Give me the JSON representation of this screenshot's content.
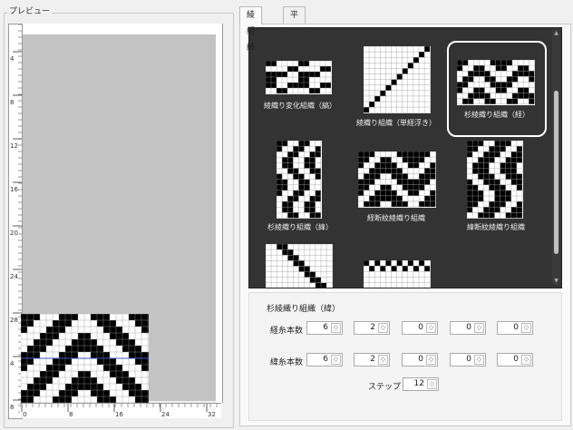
{
  "preview": {
    "title": "プレビュー",
    "v_ticks": [
      "4",
      "8",
      "12",
      "16",
      "20",
      "24",
      "28",
      "4",
      "8"
    ],
    "h_ticks": [
      "0",
      "8",
      "16",
      "24",
      "32"
    ]
  },
  "tabs": [
    {
      "label": "綾組織",
      "active": true
    },
    {
      "label": "平組織",
      "active": false
    }
  ],
  "gallery": {
    "items": [
      {
        "caption": "綾織り変化組織（縞）",
        "selected": false
      },
      {
        "caption": "綾織り組織（単経浮き）",
        "selected": false
      },
      {
        "caption": "杉綾織り組織（経）",
        "selected": true
      },
      {
        "caption": "杉綾織り組織（緯）",
        "selected": false
      },
      {
        "caption": "経断紋綾織り組織",
        "selected": false
      },
      {
        "caption": "緯断紋綾織り組織",
        "selected": false
      },
      {
        "caption": "",
        "selected": false
      },
      {
        "caption": "",
        "selected": false
      }
    ]
  },
  "settings": {
    "selected_name": "杉綾織り組織（緯）",
    "warp_label": "経糸本数",
    "weft_label": "緯糸本数",
    "warp_values": [
      "6",
      "2",
      "0",
      "0",
      "0"
    ],
    "weft_values": [
      "6",
      "2",
      "0",
      "0",
      "0"
    ],
    "step_label": "ステップ =",
    "step_value": "12",
    "spin_icon": "up-down-spinner-icon"
  },
  "colors": {
    "gallery_bg": "#333333",
    "preview_bg": "#c3c3c3",
    "selection": "#ffffff"
  }
}
